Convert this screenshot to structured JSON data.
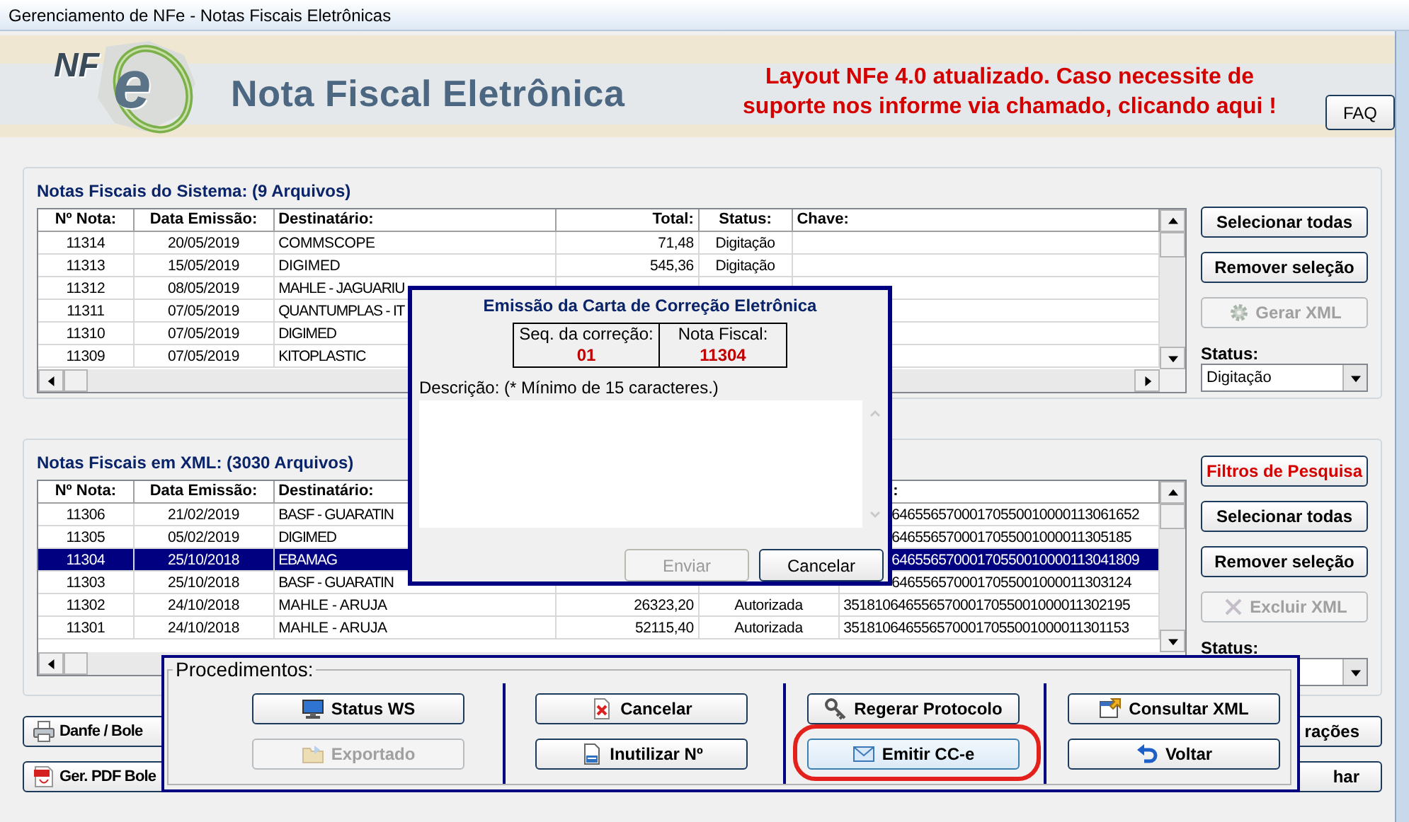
{
  "window": {
    "title": "Gerenciamento de NFe - Notas Fiscais Eletrônicas"
  },
  "banner": {
    "logo_prefix": "NF",
    "logo_letter": "e",
    "title": "Nota Fiscal Eletrônica",
    "notice_lines": [
      "Layout NFe 4.0 atualizado. Caso necessite de",
      "suporte nos informe via chamado, clicando aqui !"
    ],
    "faq_button": "FAQ"
  },
  "system_notes": {
    "title": "Notas Fiscais do Sistema: (9 Arquivos)",
    "header": {
      "number": "Nº Nota:",
      "date": "Data Emissão:",
      "recipient": "Destinatário:",
      "total": "Total:",
      "status": "Status:",
      "key": "Chave:"
    },
    "rows": [
      {
        "number": "11314",
        "date": "20/05/2019",
        "recipient": "COMMSCOPE",
        "total": "71,48",
        "status": "Digitação",
        "selected": false,
        "under_dialog": false
      },
      {
        "number": "11313",
        "date": "15/05/2019",
        "recipient": "DIGIMED",
        "total": "545,36",
        "status": "Digitação",
        "selected": false,
        "under_dialog": false
      },
      {
        "number": "11312",
        "date": "08/05/2019",
        "recipient": "MAHLE - JAGUARIU",
        "selected": false,
        "under_dialog": true
      },
      {
        "number": "11311",
        "date": "07/05/2019",
        "recipient": "QUANTUMPLAS - IT",
        "selected": false,
        "under_dialog": true
      },
      {
        "number": "11310",
        "date": "07/05/2019",
        "recipient": "DIGIMED",
        "selected": false,
        "under_dialog": true
      },
      {
        "number": "11309",
        "date": "07/05/2019",
        "recipient": "KITOPLASTIC",
        "selected": false,
        "under_dialog": true
      }
    ],
    "buttons": [
      {
        "label": "Selecionar todas",
        "kind": "plain",
        "disabled": false
      },
      {
        "label": "Remover seleção",
        "kind": "plain",
        "disabled": false
      },
      {
        "label": "Gerar XML",
        "kind": "generate",
        "disabled": true
      }
    ],
    "status_label": "Status:",
    "status_value": "Digitação"
  },
  "xml_notes": {
    "title": "Notas Fiscais em XML: (3030 Arquivos)",
    "header": {
      "number": "Nº Nota:",
      "date": "Data Emissão:",
      "recipient": "Destinatário:",
      "key": ":",
      "under_dialog": true
    },
    "rows": [
      {
        "number": "11306",
        "date": "21/02/2019",
        "recipient": "BASF - GUARATIN",
        "key": "64655657000170550010000113061652",
        "selected": false,
        "under_dialog": true
      },
      {
        "number": "11305",
        "date": "05/02/2019",
        "recipient": "DIGIMED",
        "key": "6465565700017055001000011305185",
        "selected": false,
        "under_dialog": true
      },
      {
        "number": "11304",
        "date": "25/10/2018",
        "recipient": "EBAMAG",
        "key": "64655657000170550010000113041809",
        "selected": true,
        "under_dialog": true
      },
      {
        "number": "11303",
        "date": "25/10/2018",
        "recipient": "BASF - GUARATIN",
        "key": "6465565700017055001000011303124",
        "selected": false,
        "under_dialog": true
      },
      {
        "number": "11302",
        "date": "24/10/2018",
        "recipient": "MAHLE - ARUJA",
        "total": "26323,20",
        "status": "Autorizada",
        "key": "3518106465565700017055001000011302195",
        "selected": false,
        "under_dialog": false
      },
      {
        "number": "11301",
        "date": "24/10/2018",
        "recipient": "MAHLE - ARUJA",
        "total": "52115,40",
        "status": "Autorizada",
        "key": "3518106465565700017055001000011301153",
        "selected": false,
        "under_dialog": false
      }
    ],
    "buttons": [
      {
        "label": "Filtros de Pesquisa",
        "kind": "filter",
        "disabled": false
      },
      {
        "label": "Selecionar todas",
        "kind": "plain",
        "disabled": false
      },
      {
        "label": "Remover seleção",
        "kind": "plain",
        "disabled": false
      },
      {
        "label": "Excluir XML",
        "kind": "delete",
        "disabled": true
      }
    ],
    "status_label": "Status:"
  },
  "bottom_buttons": {
    "left": [
      {
        "label": "Danfe / Bole",
        "kind": "print"
      },
      {
        "label": "Ger. PDF Bole",
        "kind": "pdf"
      }
    ],
    "right": [
      {
        "label": "rações"
      },
      {
        "label": "har"
      }
    ]
  },
  "procedures": {
    "title": "Procedimentos:",
    "groups": [
      [
        {
          "label": "Status WS",
          "kind": "status",
          "disabled": false,
          "highlighted": false
        },
        {
          "label": "Exportado",
          "kind": "export",
          "disabled": true,
          "highlighted": false
        }
      ],
      [
        {
          "label": "Cancelar",
          "kind": "cancel",
          "disabled": false,
          "highlighted": false
        },
        {
          "label": "Inutilizar Nº",
          "kind": "void",
          "disabled": false,
          "highlighted": false
        }
      ],
      [
        {
          "label": "Regerar Protocolo",
          "kind": "regenerate",
          "disabled": false,
          "highlighted": false
        },
        {
          "label": "Emitir CC-e",
          "kind": "emit",
          "disabled": false,
          "highlighted": true
        }
      ],
      [
        {
          "label": "Consultar XML",
          "kind": "consult",
          "disabled": false,
          "highlighted": false
        },
        {
          "label": "Voltar",
          "kind": "back",
          "disabled": false,
          "highlighted": false
        }
      ]
    ]
  },
  "dialog": {
    "title": "Emissão da Carta de Correção Eletrônica",
    "seq_label": "Seq. da correção:",
    "seq_value": "01",
    "note_label": "Nota Fiscal:",
    "note_value": "11304",
    "description_label": "Descrição: (* Mínimo de 15 caracteres.)",
    "buttons": [
      {
        "label": "Enviar",
        "disabled": true
      },
      {
        "label": "Cancelar",
        "disabled": false
      }
    ]
  }
}
